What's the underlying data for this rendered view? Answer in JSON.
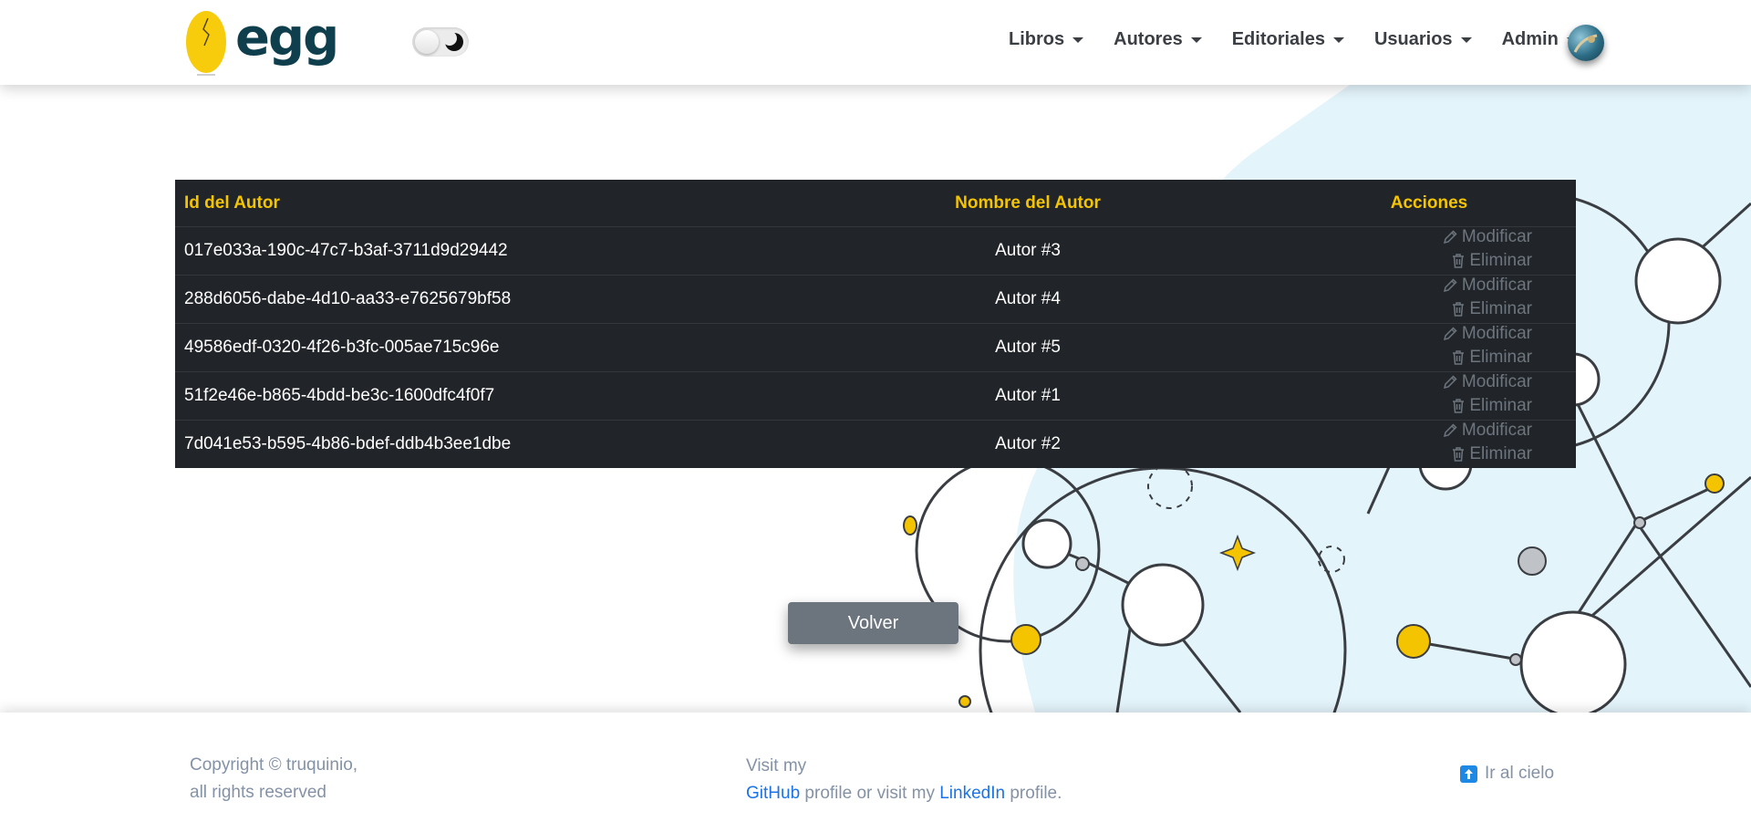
{
  "brand": {
    "name": "egg"
  },
  "nav": {
    "items": [
      {
        "label": "Libros"
      },
      {
        "label": "Autores"
      },
      {
        "label": "Editoriales"
      },
      {
        "label": "Usuarios"
      },
      {
        "label": "Admin"
      }
    ]
  },
  "table": {
    "headers": [
      "Id del Autor",
      "Nombre del Autor",
      "Acciones"
    ],
    "rows": [
      {
        "id": "017e033a-190c-47c7-b3af-3711d9d29442",
        "name": "Autor #3"
      },
      {
        "id": "288d6056-dabe-4d10-aa33-e7625679bf58",
        "name": "Autor #4"
      },
      {
        "id": "49586edf-0320-4f26-b3fc-005ae715c96e",
        "name": "Autor #5"
      },
      {
        "id": "51f2e46e-b865-4bdd-be3c-1600dfc4f0f7",
        "name": "Autor #1"
      },
      {
        "id": "7d041e53-b595-4b86-bdef-ddb4b3ee1dbe",
        "name": "Autor #2"
      }
    ],
    "actions": {
      "modify": "Modificar",
      "delete": "Eliminar"
    }
  },
  "back_button": {
    "label": "Volver"
  },
  "footer": {
    "copyright_line1": "Copyright © truquinio,",
    "copyright_line2": "all rights reserved",
    "visit_prefix": "Visit my",
    "github": "GitHub",
    "middle": " profile or visit my ",
    "linkedin": "LinkedIn",
    "suffix": " profile.",
    "up_label": "Ir al cielo"
  },
  "colors": {
    "table_bg": "#212529",
    "header_text": "#f5c400",
    "action_muted": "#6c757d",
    "brand_dark": "#0f3f4c",
    "egg_yellow": "#f7cc0d",
    "link": "#1a73e8"
  },
  "icons": [
    "egg-logo-icon",
    "moon-icon",
    "pencil-icon",
    "trash-icon",
    "arrow-up-icon"
  ]
}
